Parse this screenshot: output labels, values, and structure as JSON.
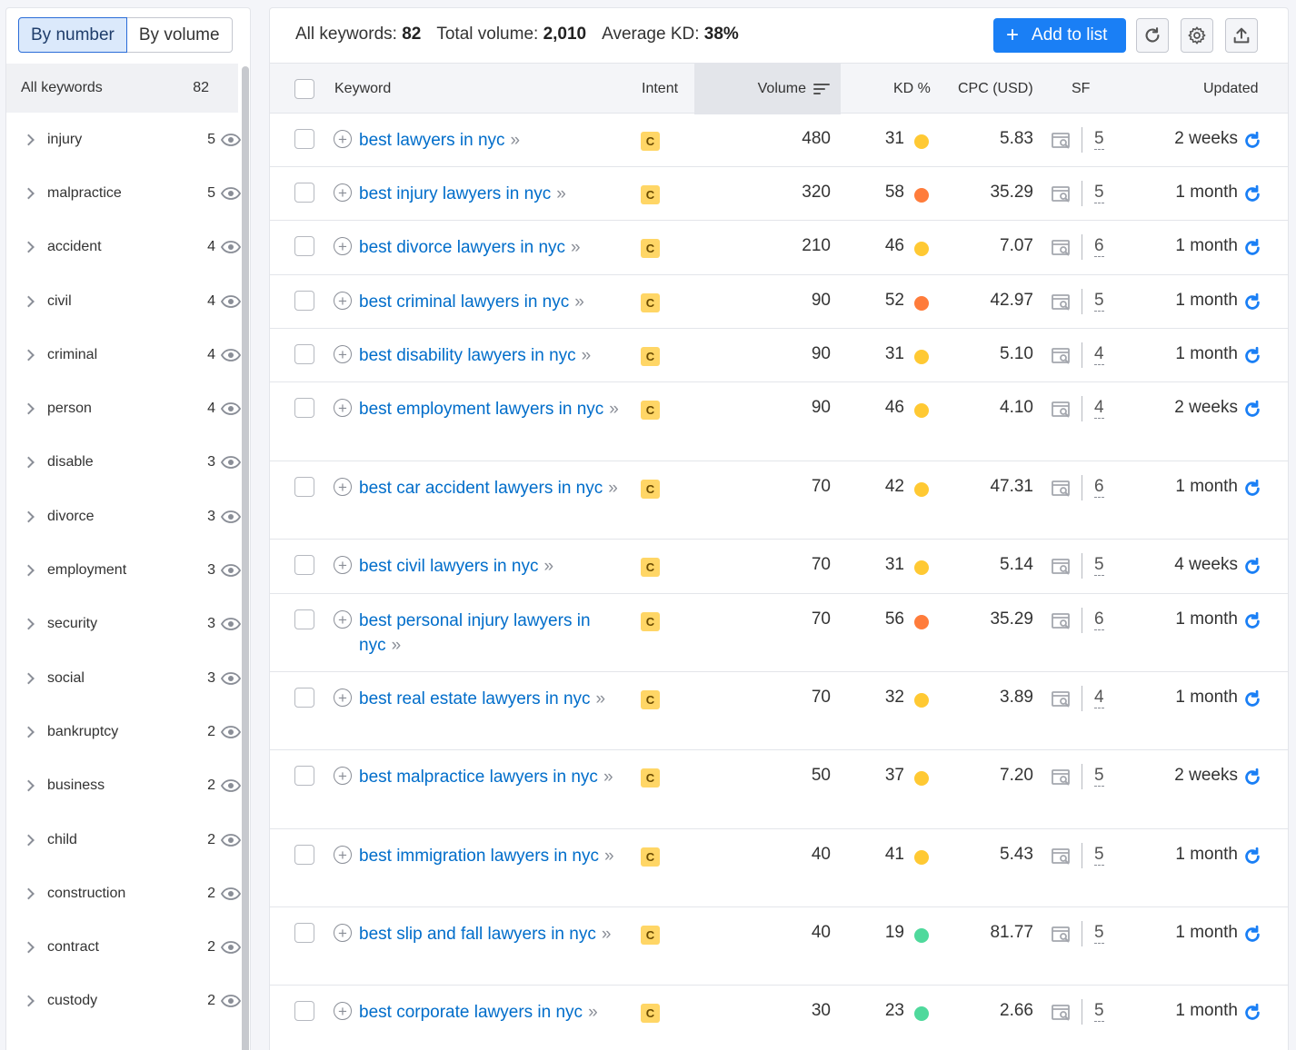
{
  "toggle": {
    "by_number": "By number",
    "by_volume": "By volume"
  },
  "sidebar": {
    "all_label": "All keywords",
    "all_count": "82",
    "groups": [
      {
        "name": "injury",
        "count": "5"
      },
      {
        "name": "malpractice",
        "count": "5"
      },
      {
        "name": "accident",
        "count": "4"
      },
      {
        "name": "civil",
        "count": "4"
      },
      {
        "name": "criminal",
        "count": "4"
      },
      {
        "name": "person",
        "count": "4"
      },
      {
        "name": "disable",
        "count": "3"
      },
      {
        "name": "divorce",
        "count": "3"
      },
      {
        "name": "employment",
        "count": "3"
      },
      {
        "name": "security",
        "count": "3"
      },
      {
        "name": "social",
        "count": "3"
      },
      {
        "name": "bankruptcy",
        "count": "2"
      },
      {
        "name": "business",
        "count": "2"
      },
      {
        "name": "child",
        "count": "2"
      },
      {
        "name": "construction",
        "count": "2"
      },
      {
        "name": "contract",
        "count": "2"
      },
      {
        "name": "custody",
        "count": "2"
      }
    ]
  },
  "stats": {
    "all_label": "All keywords:",
    "all_value": "82",
    "volume_label": "Total volume:",
    "volume_value": "2,010",
    "kd_label": "Average KD:",
    "kd_value": "38%"
  },
  "toolbar": {
    "add_label": "Add to list"
  },
  "columns": {
    "keyword": "Keyword",
    "intent": "Intent",
    "volume": "Volume",
    "kd": "KD %",
    "cpc": "CPC (USD)",
    "sf": "SF",
    "updated": "Updated"
  },
  "colors": {
    "accent": "#1a7ff5",
    "kd_yellow": "#ffc933",
    "kd_orange": "#ff7c3b",
    "kd_green": "#4fd99c",
    "intent_commercial": "#ffd666"
  },
  "rows": [
    {
      "kw": "best lawyers in nyc",
      "intent": "C",
      "volume": "480",
      "kd": "31",
      "kd_color": "yellow",
      "cpc": "5.83",
      "sf": "5",
      "updated": "2 weeks"
    },
    {
      "kw": "best injury lawyers in nyc",
      "intent": "C",
      "volume": "320",
      "kd": "58",
      "kd_color": "orange",
      "cpc": "35.29",
      "sf": "5",
      "updated": "1 month"
    },
    {
      "kw": "best divorce lawyers in nyc",
      "intent": "C",
      "volume": "210",
      "kd": "46",
      "kd_color": "yellow",
      "cpc": "7.07",
      "sf": "6",
      "updated": "1 month"
    },
    {
      "kw": "best criminal lawyers in nyc",
      "intent": "C",
      "volume": "90",
      "kd": "52",
      "kd_color": "orange",
      "cpc": "42.97",
      "sf": "5",
      "updated": "1 month"
    },
    {
      "kw": "best disability lawyers in nyc",
      "intent": "C",
      "volume": "90",
      "kd": "31",
      "kd_color": "yellow",
      "cpc": "5.10",
      "sf": "4",
      "updated": "1 month"
    },
    {
      "kw": "best employment lawyers in nyc",
      "intent": "C",
      "volume": "90",
      "kd": "46",
      "kd_color": "yellow",
      "cpc": "4.10",
      "sf": "4",
      "updated": "2 weeks"
    },
    {
      "kw": "best car accident lawyers in nyc",
      "intent": "C",
      "volume": "70",
      "kd": "42",
      "kd_color": "yellow",
      "cpc": "47.31",
      "sf": "6",
      "updated": "1 month"
    },
    {
      "kw": "best civil lawyers in nyc",
      "intent": "C",
      "volume": "70",
      "kd": "31",
      "kd_color": "yellow",
      "cpc": "5.14",
      "sf": "5",
      "updated": "4 weeks"
    },
    {
      "kw": "best personal injury lawyers in nyc",
      "intent": "C",
      "volume": "70",
      "kd": "56",
      "kd_color": "orange",
      "cpc": "35.29",
      "sf": "6",
      "updated": "1 month"
    },
    {
      "kw": "best real estate lawyers in nyc",
      "intent": "C",
      "volume": "70",
      "kd": "32",
      "kd_color": "yellow",
      "cpc": "3.89",
      "sf": "4",
      "updated": "1 month"
    },
    {
      "kw": "best malpractice lawyers in nyc",
      "intent": "C",
      "volume": "50",
      "kd": "37",
      "kd_color": "yellow",
      "cpc": "7.20",
      "sf": "5",
      "updated": "2 weeks"
    },
    {
      "kw": "best immigration lawyers in nyc",
      "intent": "C",
      "volume": "40",
      "kd": "41",
      "kd_color": "yellow",
      "cpc": "5.43",
      "sf": "5",
      "updated": "1 month"
    },
    {
      "kw": "best slip and fall lawyers in nyc",
      "intent": "C",
      "volume": "40",
      "kd": "19",
      "kd_color": "green",
      "cpc": "81.77",
      "sf": "5",
      "updated": "1 month"
    },
    {
      "kw": "best corporate lawyers in nyc",
      "intent": "C",
      "volume": "30",
      "kd": "23",
      "kd_color": "green",
      "cpc": "2.66",
      "sf": "5",
      "updated": "1 month"
    }
  ]
}
